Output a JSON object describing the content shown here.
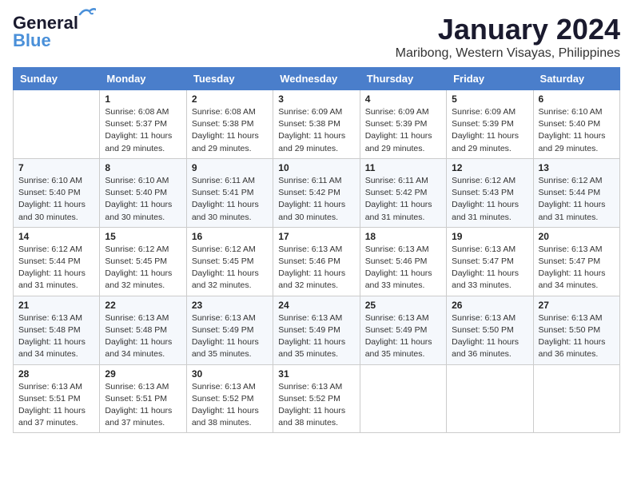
{
  "header": {
    "logo_line1": "General",
    "logo_line2": "Blue",
    "month_title": "January 2024",
    "location": "Maribong, Western Visayas, Philippines"
  },
  "days_of_week": [
    "Sunday",
    "Monday",
    "Tuesday",
    "Wednesday",
    "Thursday",
    "Friday",
    "Saturday"
  ],
  "weeks": [
    [
      {
        "day": "",
        "sunrise": "",
        "sunset": "",
        "daylight": ""
      },
      {
        "day": "1",
        "sunrise": "6:08 AM",
        "sunset": "5:37 PM",
        "daylight": "11 hours and 29 minutes."
      },
      {
        "day": "2",
        "sunrise": "6:08 AM",
        "sunset": "5:38 PM",
        "daylight": "11 hours and 29 minutes."
      },
      {
        "day": "3",
        "sunrise": "6:09 AM",
        "sunset": "5:38 PM",
        "daylight": "11 hours and 29 minutes."
      },
      {
        "day": "4",
        "sunrise": "6:09 AM",
        "sunset": "5:39 PM",
        "daylight": "11 hours and 29 minutes."
      },
      {
        "day": "5",
        "sunrise": "6:09 AM",
        "sunset": "5:39 PM",
        "daylight": "11 hours and 29 minutes."
      },
      {
        "day": "6",
        "sunrise": "6:10 AM",
        "sunset": "5:40 PM",
        "daylight": "11 hours and 29 minutes."
      }
    ],
    [
      {
        "day": "7",
        "sunrise": "6:10 AM",
        "sunset": "5:40 PM",
        "daylight": "11 hours and 30 minutes."
      },
      {
        "day": "8",
        "sunrise": "6:10 AM",
        "sunset": "5:40 PM",
        "daylight": "11 hours and 30 minutes."
      },
      {
        "day": "9",
        "sunrise": "6:11 AM",
        "sunset": "5:41 PM",
        "daylight": "11 hours and 30 minutes."
      },
      {
        "day": "10",
        "sunrise": "6:11 AM",
        "sunset": "5:42 PM",
        "daylight": "11 hours and 30 minutes."
      },
      {
        "day": "11",
        "sunrise": "6:11 AM",
        "sunset": "5:42 PM",
        "daylight": "11 hours and 31 minutes."
      },
      {
        "day": "12",
        "sunrise": "6:12 AM",
        "sunset": "5:43 PM",
        "daylight": "11 hours and 31 minutes."
      },
      {
        "day": "13",
        "sunrise": "6:12 AM",
        "sunset": "5:44 PM",
        "daylight": "11 hours and 31 minutes."
      }
    ],
    [
      {
        "day": "14",
        "sunrise": "6:12 AM",
        "sunset": "5:44 PM",
        "daylight": "11 hours and 31 minutes."
      },
      {
        "day": "15",
        "sunrise": "6:12 AM",
        "sunset": "5:45 PM",
        "daylight": "11 hours and 32 minutes."
      },
      {
        "day": "16",
        "sunrise": "6:12 AM",
        "sunset": "5:45 PM",
        "daylight": "11 hours and 32 minutes."
      },
      {
        "day": "17",
        "sunrise": "6:13 AM",
        "sunset": "5:46 PM",
        "daylight": "11 hours and 32 minutes."
      },
      {
        "day": "18",
        "sunrise": "6:13 AM",
        "sunset": "5:46 PM",
        "daylight": "11 hours and 33 minutes."
      },
      {
        "day": "19",
        "sunrise": "6:13 AM",
        "sunset": "5:47 PM",
        "daylight": "11 hours and 33 minutes."
      },
      {
        "day": "20",
        "sunrise": "6:13 AM",
        "sunset": "5:47 PM",
        "daylight": "11 hours and 34 minutes."
      }
    ],
    [
      {
        "day": "21",
        "sunrise": "6:13 AM",
        "sunset": "5:48 PM",
        "daylight": "11 hours and 34 minutes."
      },
      {
        "day": "22",
        "sunrise": "6:13 AM",
        "sunset": "5:48 PM",
        "daylight": "11 hours and 34 minutes."
      },
      {
        "day": "23",
        "sunrise": "6:13 AM",
        "sunset": "5:49 PM",
        "daylight": "11 hours and 35 minutes."
      },
      {
        "day": "24",
        "sunrise": "6:13 AM",
        "sunset": "5:49 PM",
        "daylight": "11 hours and 35 minutes."
      },
      {
        "day": "25",
        "sunrise": "6:13 AM",
        "sunset": "5:49 PM",
        "daylight": "11 hours and 35 minutes."
      },
      {
        "day": "26",
        "sunrise": "6:13 AM",
        "sunset": "5:50 PM",
        "daylight": "11 hours and 36 minutes."
      },
      {
        "day": "27",
        "sunrise": "6:13 AM",
        "sunset": "5:50 PM",
        "daylight": "11 hours and 36 minutes."
      }
    ],
    [
      {
        "day": "28",
        "sunrise": "6:13 AM",
        "sunset": "5:51 PM",
        "daylight": "11 hours and 37 minutes."
      },
      {
        "day": "29",
        "sunrise": "6:13 AM",
        "sunset": "5:51 PM",
        "daylight": "11 hours and 37 minutes."
      },
      {
        "day": "30",
        "sunrise": "6:13 AM",
        "sunset": "5:52 PM",
        "daylight": "11 hours and 38 minutes."
      },
      {
        "day": "31",
        "sunrise": "6:13 AM",
        "sunset": "5:52 PM",
        "daylight": "11 hours and 38 minutes."
      },
      {
        "day": "",
        "sunrise": "",
        "sunset": "",
        "daylight": ""
      },
      {
        "day": "",
        "sunrise": "",
        "sunset": "",
        "daylight": ""
      },
      {
        "day": "",
        "sunrise": "",
        "sunset": "",
        "daylight": ""
      }
    ]
  ]
}
